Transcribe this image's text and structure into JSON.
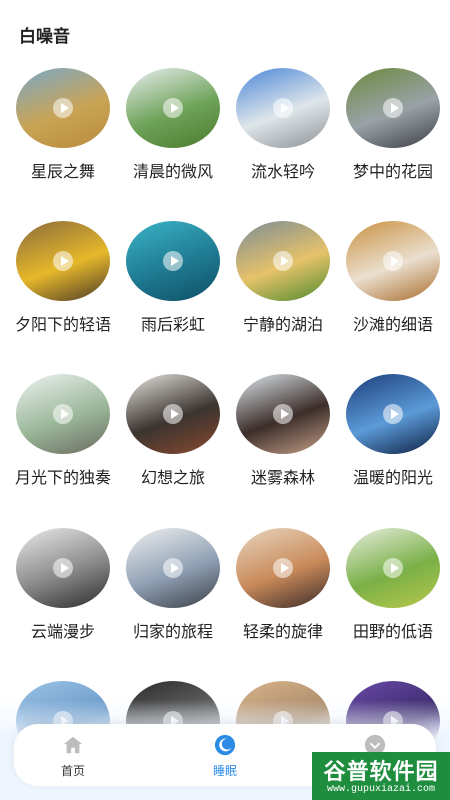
{
  "page": {
    "title": "白噪音"
  },
  "sounds": [
    {
      "label": "星辰之舞",
      "colors": [
        "#7aa8c8",
        "#c9a455",
        "#b98a3a"
      ]
    },
    {
      "label": "清晨的微风",
      "colors": [
        "#e9eef0",
        "#6fa35a",
        "#4b7a2c"
      ]
    },
    {
      "label": "流水轻吟",
      "colors": [
        "#4a86d8",
        "#dfe6ea",
        "#8a8f93"
      ]
    },
    {
      "label": "梦中的花园",
      "colors": [
        "#6b8a3e",
        "#9aa2a8",
        "#3b3e44"
      ]
    },
    {
      "label": "夕阳下的轻语",
      "colors": [
        "#8a6a3c",
        "#e6b82a",
        "#4c3a28"
      ]
    },
    {
      "label": "雨后彩虹",
      "colors": [
        "#3ab4c8",
        "#1f7a92",
        "#0d4f66"
      ]
    },
    {
      "label": "宁静的湖泊",
      "colors": [
        "#7c8c96",
        "#e6c26a",
        "#4f8a2e"
      ]
    },
    {
      "label": "沙滩的细语",
      "colors": [
        "#c9903f",
        "#eadfcf",
        "#a86b2a"
      ]
    },
    {
      "label": "月光下的独奏",
      "colors": [
        "#eef2f2",
        "#9bb89a",
        "#6a6a5e"
      ]
    },
    {
      "label": "幻想之旅",
      "colors": [
        "#e8e6e2",
        "#3b3430",
        "#8a4a2e"
      ]
    },
    {
      "label": "迷雾森林",
      "colors": [
        "#dfe8ee",
        "#3c2e2a",
        "#c9a28a"
      ]
    },
    {
      "label": "温暖的阳光",
      "colors": [
        "#1b3e7a",
        "#5c9ad8",
        "#0b1e3e"
      ]
    },
    {
      "label": "云端漫步",
      "colors": [
        "#eaeaea",
        "#8a8a8a",
        "#2a2a2a"
      ]
    },
    {
      "label": "归家的旅程",
      "colors": [
        "#f0f0f0",
        "#8fa0b4",
        "#3a3e46"
      ]
    },
    {
      "label": "轻柔的旋律",
      "colors": [
        "#e8d6c0",
        "#c98a5a",
        "#3a2a28"
      ]
    },
    {
      "label": "田野的低语",
      "colors": [
        "#e8eee0",
        "#7ab048",
        "#b8c84a"
      ]
    },
    {
      "label": "",
      "colors": [
        "#9cc3e6",
        "#6a9ac8",
        "#b8d4ee"
      ]
    },
    {
      "label": "",
      "colors": [
        "#2a2a2a",
        "#6a6a6a",
        "#c8c8c8"
      ]
    },
    {
      "label": "",
      "colors": [
        "#d8b48a",
        "#a88a6a",
        "#e8d0b0"
      ]
    },
    {
      "label": "",
      "colors": [
        "#6a4aa8",
        "#3a2a6a",
        "#9a7ad8"
      ]
    }
  ],
  "tabbar": {
    "tabs": [
      {
        "label": "首页",
        "icon": "home-icon",
        "active": false
      },
      {
        "label": "睡眠",
        "icon": "moon-icon",
        "active": true
      },
      {
        "label": "",
        "icon": "profile-icon",
        "active": false
      }
    ],
    "accent": "#2b8be6",
    "inactive_icon_color": "#bdbdbd"
  },
  "watermark": {
    "main": "谷普软件园",
    "url": "www.gupuxiazai.com"
  }
}
